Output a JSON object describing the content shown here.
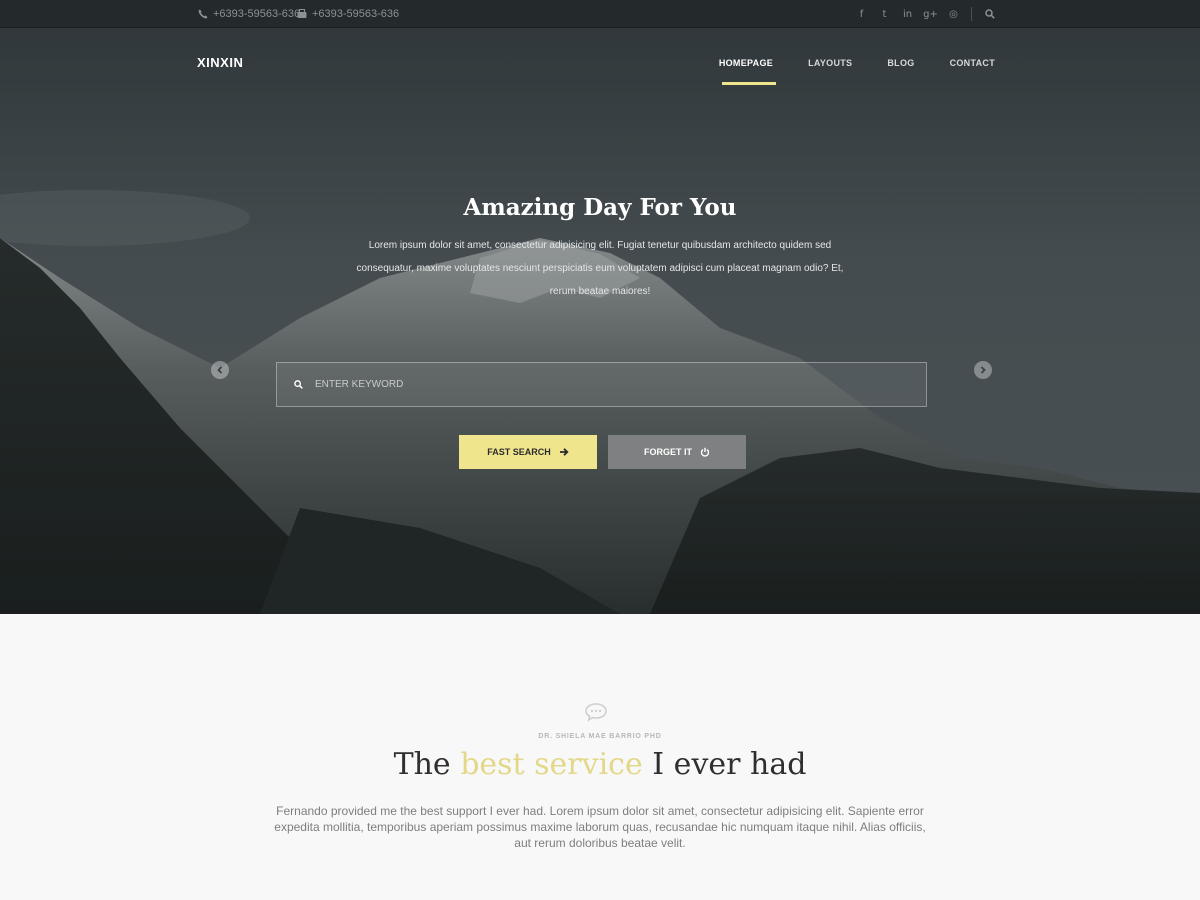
{
  "topbar": {
    "phone": "+6393-59563-636",
    "fax": "+6393-59563-636",
    "social": [
      {
        "icon": "facebook-icon",
        "glyph": "f"
      },
      {
        "icon": "twitter-icon",
        "glyph": "t"
      },
      {
        "icon": "linkedin-icon",
        "glyph": "in"
      },
      {
        "icon": "google-plus-icon",
        "glyph": "g+"
      },
      {
        "icon": "dribbble-icon",
        "glyph": "◎"
      }
    ]
  },
  "header": {
    "logo": "XINXIN",
    "nav": [
      {
        "label": "HOMEPAGE",
        "active": true
      },
      {
        "label": "LAYOUTS",
        "active": false
      },
      {
        "label": "BLOG",
        "active": false
      },
      {
        "label": "CONTACT",
        "active": false
      }
    ]
  },
  "hero": {
    "title": "Amazing Day For You",
    "text": "Lorem ipsum dolor sit amet, consectetur adipisicing elit. Fugiat tenetur quibusdam architecto quidem sed consequatur, maxime voluptates nesciunt perspiciatis eum voluptatem adipisci cum placeat magnam odio? Et, rerum beatae maiores!",
    "search_placeholder": "ENTER KEYWORD",
    "primary_button": "FAST SEARCH",
    "secondary_button": "FORGET IT"
  },
  "testimonial": {
    "author": "DR. SHIELA MAE BARRIO PHD",
    "heading_before": "The",
    "heading_highlight": "best service",
    "heading_after": "I ever had",
    "text": "Fernando provided me the best support I ever had. Lorem ipsum dolor sit amet, consectetur adipisicing elit. Sapiente error expedita mollitia, temporibus aperiam possimus maxime laborum quas, recusandae hic numquam itaque nihil. Alias officiis, aut rerum doloribus beatae velit."
  },
  "colors": {
    "accent": "#efe58c",
    "topbar_bg": "#24292c",
    "secondary_button": "#7f8081"
  }
}
